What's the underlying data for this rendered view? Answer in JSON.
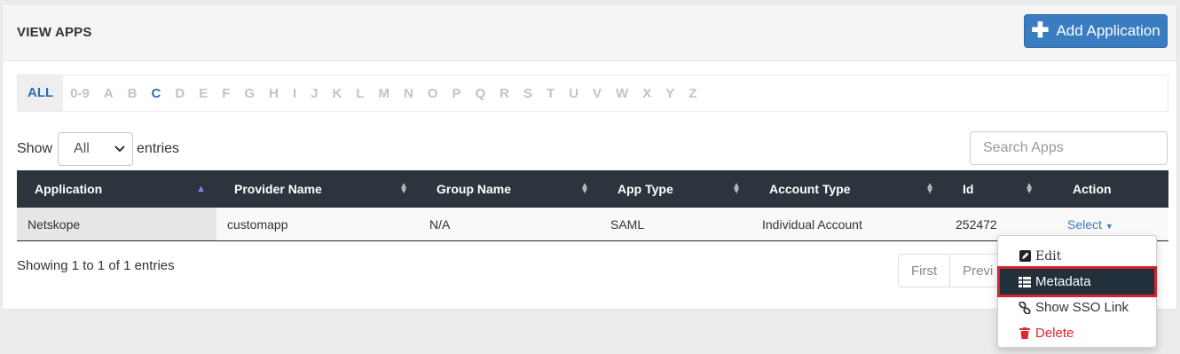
{
  "header": {
    "title": "VIEW APPS",
    "add_label": "Add Application"
  },
  "alphabet": {
    "all": "ALL",
    "letters": [
      "0-9",
      "A",
      "B",
      "C",
      "D",
      "E",
      "F",
      "G",
      "H",
      "I",
      "J",
      "K",
      "L",
      "M",
      "N",
      "O",
      "P",
      "Q",
      "R",
      "S",
      "T",
      "U",
      "V",
      "W",
      "X",
      "Y",
      "Z"
    ],
    "active": "C"
  },
  "entries": {
    "show_label": "Show",
    "select_value": "All",
    "entries_label": "entries"
  },
  "search": {
    "placeholder": "Search Apps"
  },
  "table": {
    "columns": [
      "Application",
      "Provider Name",
      "Group Name",
      "App Type",
      "Account Type",
      "Id",
      "Action"
    ],
    "rows": [
      {
        "application": "Netskope",
        "provider": "customapp",
        "group": "N/A",
        "app_type": "SAML",
        "account_type": "Individual Account",
        "id": "252472",
        "action": "Select"
      }
    ]
  },
  "info": "Showing 1 to 1 of 1 entries",
  "pagination": {
    "first": "First",
    "previous": "Previ"
  },
  "dropdown": {
    "edit": "Edit",
    "metadata": "Metadata",
    "sso": "Show SSO Link",
    "delete": "Delete"
  },
  "colors": {
    "primary": "#3a7cc0",
    "header_bg": "#2c353d",
    "danger": "#e0252b",
    "highlight_border": "#d2242c"
  }
}
